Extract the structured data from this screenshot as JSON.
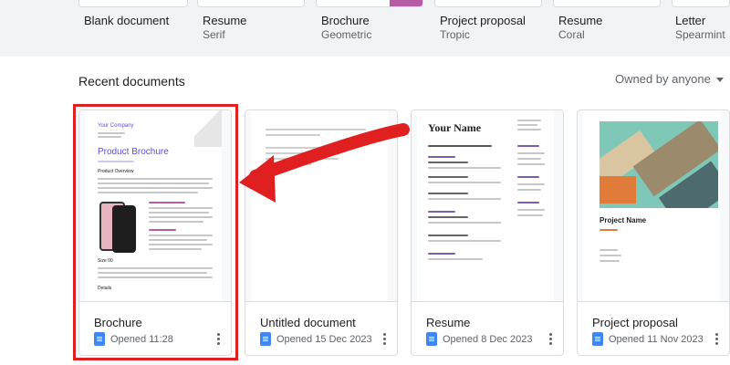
{
  "templates": [
    {
      "name": "Blank document",
      "subtitle": ""
    },
    {
      "name": "Resume",
      "subtitle": "Serif"
    },
    {
      "name": "Brochure",
      "subtitle": "Geometric"
    },
    {
      "name": "Project proposal",
      "subtitle": "Tropic"
    },
    {
      "name": "Resume",
      "subtitle": "Coral"
    },
    {
      "name": "Letter",
      "subtitle": "Spearmint"
    }
  ],
  "recent": {
    "title": "Recent documents",
    "owner_filter": "Owned by anyone"
  },
  "documents": [
    {
      "title": "Brochure",
      "opened": "Opened 11:28"
    },
    {
      "title": "Untitled document",
      "opened": "Opened 15 Dec 2023"
    },
    {
      "title": "Resume",
      "opened": "Opened 8 Dec 2023"
    },
    {
      "title": "Project proposal",
      "opened": "Opened 11 Nov 2023"
    }
  ],
  "previews": {
    "brochure": {
      "company": "Your Company",
      "title": "Product Brochure",
      "section1": "Product Overview",
      "section2": "Size 00",
      "section3": "Details"
    },
    "resume": {
      "name": "Your Name"
    },
    "proposal": {
      "title": "Project Name"
    }
  },
  "colors": {
    "highlight": "#e02020",
    "doc_icon": "#4285f4"
  }
}
